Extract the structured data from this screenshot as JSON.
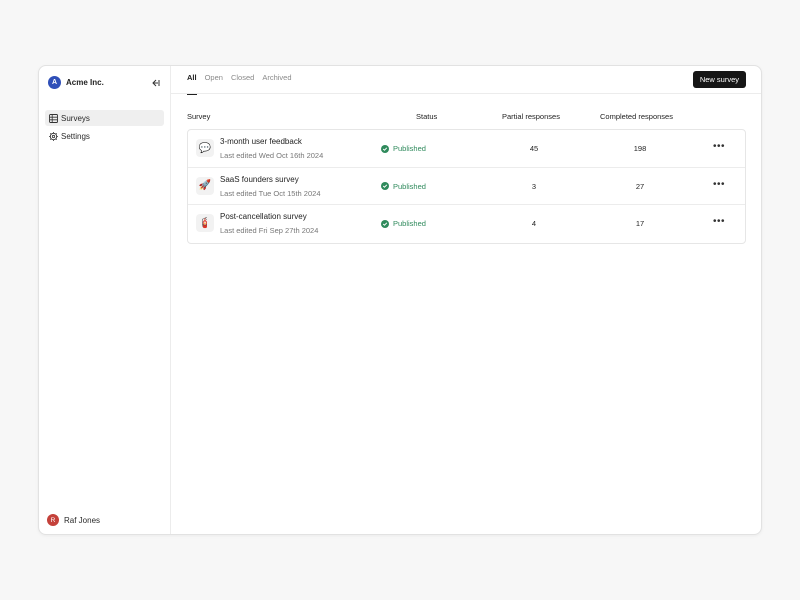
{
  "sidebar": {
    "org": {
      "initial": "A",
      "name": "Acme Inc.",
      "avatar_color": "#2f4fb8"
    },
    "collapse_icon": "collapse-sidebar-icon",
    "items": [
      {
        "label": "Surveys",
        "icon": "table-icon",
        "active": true
      },
      {
        "label": "Settings",
        "icon": "gear-icon",
        "active": false
      }
    ],
    "user": {
      "initial": "R",
      "name": "Raf Jones",
      "avatar_color": "#c4413a"
    }
  },
  "tabs": [
    {
      "label": "All",
      "active": true
    },
    {
      "label": "Open",
      "active": false
    },
    {
      "label": "Closed",
      "active": false
    },
    {
      "label": "Archived",
      "active": false
    }
  ],
  "toolbar": {
    "new_survey_label": "New survey"
  },
  "table": {
    "headers": {
      "survey": "Survey",
      "status": "Status",
      "partial": "Partial responses",
      "completed": "Completed responses"
    },
    "rows": [
      {
        "icon": "speech-bubble-icon",
        "glyph": "💬",
        "name": "3-month user feedback",
        "meta": "Last edited Wed Oct 16th 2024",
        "status": "Published",
        "partial": "45",
        "completed": "198"
      },
      {
        "icon": "rocket-icon",
        "glyph": "🚀",
        "name": "SaaS founders survey",
        "meta": "Last edited Tue Oct 15th 2024",
        "status": "Published",
        "partial": "3",
        "completed": "27"
      },
      {
        "icon": "fire-extinguisher-icon",
        "glyph": "🧯",
        "name": "Post-cancellation survey",
        "meta": "Last edited Fri Sep 27th 2024",
        "status": "Published",
        "partial": "4",
        "completed": "17"
      }
    ]
  },
  "colors": {
    "status_published": "#2f8a5c",
    "primary_button": "#161616"
  }
}
